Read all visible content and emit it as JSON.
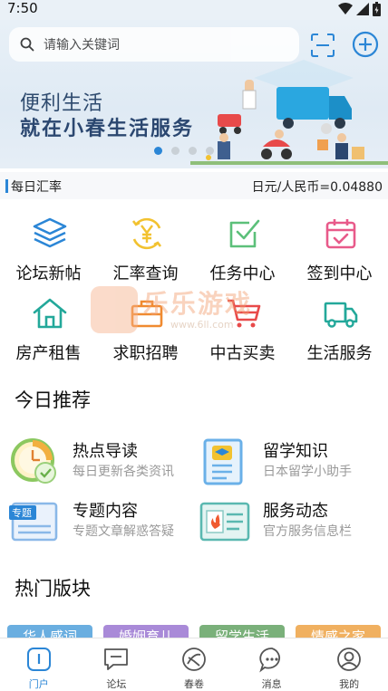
{
  "status_bar": {
    "time": "7:50"
  },
  "search": {
    "placeholder": "请输入关键词"
  },
  "banner": {
    "title": "便利生活",
    "subtitle": "就在小春生活服务",
    "slide_count": 4,
    "active_slide": 0
  },
  "exchange": {
    "label": "每日汇率",
    "value": "日元/人民币=0.04880"
  },
  "grid": [
    {
      "label": "论坛新帖",
      "icon": "layers-icon",
      "color": "#2b86d6"
    },
    {
      "label": "汇率查询",
      "icon": "yen-exchange-icon",
      "color": "#f2c230"
    },
    {
      "label": "任务中心",
      "icon": "checkbox-icon",
      "color": "#5cc07a"
    },
    {
      "label": "签到中心",
      "icon": "calendar-check-icon",
      "color": "#e85a8a"
    },
    {
      "label": "房产租售",
      "icon": "house-icon",
      "color": "#23a89a"
    },
    {
      "label": "求职招聘",
      "icon": "briefcase-icon",
      "color": "#f08a30"
    },
    {
      "label": "中古买卖",
      "icon": "shopping-cart-icon",
      "color": "#e84a4a"
    },
    {
      "label": "生活服务",
      "icon": "truck-icon",
      "color": "#23a89a"
    }
  ],
  "watermark": {
    "text": "乐乐游戏",
    "url": "www.6ll.com"
  },
  "today": {
    "title": "今日推荐",
    "items": [
      {
        "title": "热点导读",
        "subtitle": "每日更新各类资讯",
        "icon": "clock-check-icon"
      },
      {
        "title": "留学知识",
        "subtitle": "日本留学小助手",
        "icon": "graduation-doc-icon"
      },
      {
        "title": "专题内容",
        "subtitle": "专题文章解惑答疑",
        "icon": "topic-doc-icon",
        "badge": "专题"
      },
      {
        "title": "服务动态",
        "subtitle": "官方服务信息栏",
        "icon": "news-fire-icon"
      }
    ]
  },
  "hot": {
    "title": "热门版块",
    "blocks": [
      {
        "label": "华人感词",
        "color": "#6aaee0"
      },
      {
        "label": "婚姻育儿",
        "color": "#a98ad8"
      },
      {
        "label": "留学生活",
        "color": "#7ab07a"
      },
      {
        "label": "情感之家",
        "color": "#f0b060"
      }
    ]
  },
  "tabs": [
    {
      "label": "门户",
      "icon": "portal-icon",
      "active": true
    },
    {
      "label": "论坛",
      "icon": "forum-icon",
      "active": false
    },
    {
      "label": "春卷",
      "icon": "compass-icon",
      "active": false
    },
    {
      "label": "消息",
      "icon": "message-icon",
      "active": false
    },
    {
      "label": "我的",
      "icon": "profile-icon",
      "active": false
    }
  ],
  "colors": {
    "accent": "#2b86d6",
    "banner_bg": "#e3edf6"
  }
}
